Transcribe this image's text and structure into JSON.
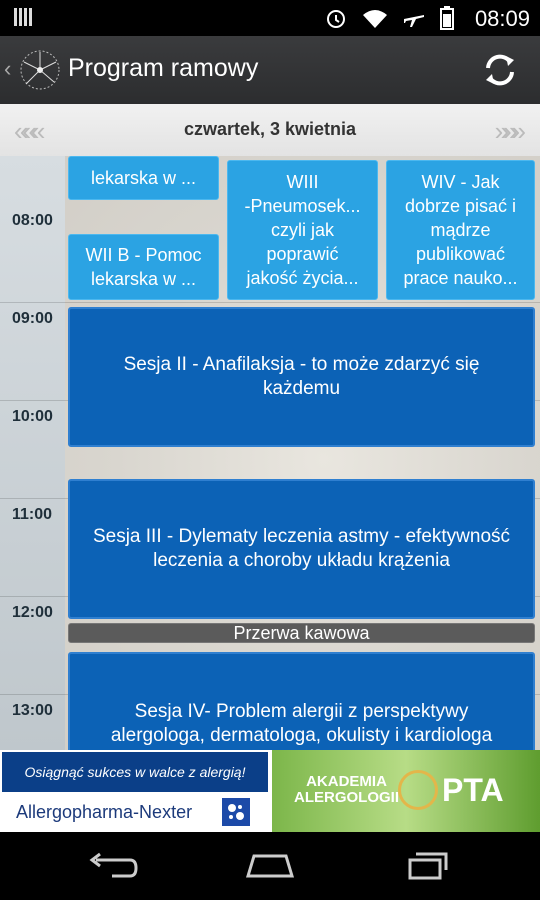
{
  "status": {
    "time": "08:09"
  },
  "app": {
    "title": "Program ramowy"
  },
  "date_nav": {
    "date": "czwartek, 3 kwietnia",
    "prev_arrows": "«««",
    "next_arrows": "»»»"
  },
  "times": [
    "08:00",
    "09:00",
    "10:00",
    "11:00",
    "12:00",
    "13:00"
  ],
  "events": {
    "e1": "lekarska w ...",
    "e2": [
      "WII B - Pomoc",
      "lekarska w ..."
    ],
    "e3": [
      "WIII",
      "-Pneumosek...",
      "czyli jak",
      "poprawić",
      "jakość życia..."
    ],
    "e4": [
      "WIV - Jak",
      "dobrze pisać i",
      "mądrze",
      "publikować",
      "prace naukо..."
    ],
    "e5": [
      "Sesja II - Anafilaksja - to może zdarzyć się",
      "każdemu"
    ],
    "e6": [
      "Sesja III - Dylematy leczenia astmy - efektywność",
      "leczenia a choroby układu krążenia"
    ],
    "e7": "Przerwa kawowa",
    "e8": [
      "Sesja IV- Problem alergii z perspektywy",
      "alergologa, dermatologa, okulisty i kardiologa"
    ]
  },
  "ad": {
    "slogan": "Osiągnąć sukces w walce z alergią!",
    "brand": "Allergopharma-Nexter",
    "akademia_line1": "AKADEMIA",
    "akademia_line2": "ALERGOLOGII",
    "pta": "PTA"
  }
}
